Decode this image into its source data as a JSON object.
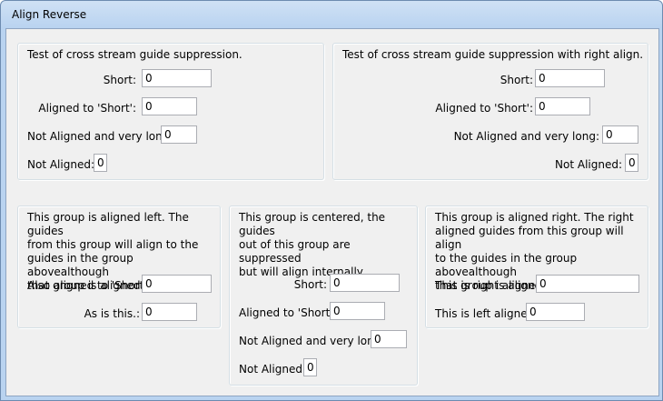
{
  "window": {
    "title": "Align Reverse"
  },
  "g1": {
    "heading": "Test of cross stream guide suppression.",
    "fields": [
      {
        "label": "Short:",
        "value": "0"
      },
      {
        "label": "Aligned to 'Short':",
        "value": "0"
      },
      {
        "label": "Not Aligned and very long:",
        "value": "0"
      },
      {
        "label": "Not Aligned:",
        "value": "0"
      }
    ]
  },
  "g2": {
    "heading": "Test of cross stream guide suppression with right align.",
    "fields": [
      {
        "label": "Short:",
        "value": "0"
      },
      {
        "label": "Aligned to 'Short':",
        "value": "0"
      },
      {
        "label": "Not Aligned and very long:",
        "value": "0"
      },
      {
        "label": "Not Aligned:",
        "value": "0"
      }
    ]
  },
  "g3": {
    "lines": [
      "This group is aligned left. The guides",
      "from this group will align to the",
      "guides in the group abovealthough",
      "that group is aligned to fill."
    ],
    "fields": [
      {
        "label": "Also aligned to 'Short':",
        "value": "0"
      },
      {
        "label": "As is this.:",
        "value": "0"
      }
    ]
  },
  "g4": {
    "lines": [
      "This group is centered, the guides",
      "out of this group are suppressed",
      "but will align internally."
    ],
    "fields": [
      {
        "label": "Short:",
        "value": "0"
      },
      {
        "label": "Aligned to 'Short':",
        "value": "0"
      },
      {
        "label": "Not Aligned and very long:",
        "value": "0"
      },
      {
        "label": "Not Aligned:",
        "value": "0"
      }
    ]
  },
  "g5": {
    "lines": [
      "This group is aligned right. The right",
      "aligned guides from this group will align",
      "to the guides in the group abovealthough",
      "that group is aligned to fill."
    ],
    "fields": [
      {
        "label": "This is right aligned:",
        "value": "0"
      },
      {
        "label": "This is left aligned:",
        "value": "0"
      }
    ]
  }
}
